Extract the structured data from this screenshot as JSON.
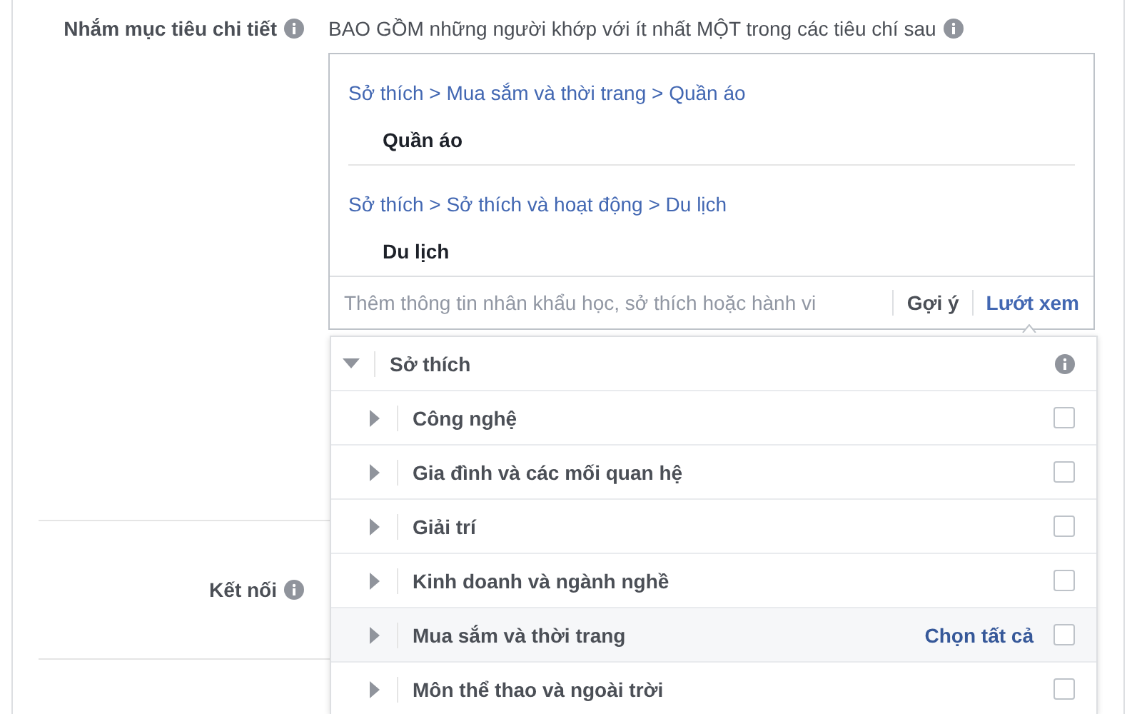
{
  "detailed_targeting": {
    "label": "Nhắm mục tiêu chi tiết",
    "description": "BAO GỒM những người khớp với ít nhất MỘT trong các tiêu chí sau",
    "selections": [
      {
        "path": "Sở thích > Mua sắm và thời trang > Quần áo",
        "item": "Quần áo"
      },
      {
        "path": "Sở thích > Sở thích và hoạt động > Du lịch",
        "item": "Du lịch"
      }
    ],
    "search": {
      "placeholder": "Thêm thông tin nhân khẩu học, sở thích hoặc hành vi"
    },
    "modes": [
      {
        "label": "Gợi ý",
        "selected": false
      },
      {
        "label": "Lướt xem",
        "selected": true
      }
    ]
  },
  "browse_panel": {
    "category": "Sở thích",
    "expanded": true,
    "select_all": "Chọn tất cả",
    "items": [
      {
        "label": "Công nghệ",
        "checked": false,
        "highlighted": false
      },
      {
        "label": "Gia đình và các mối quan hệ",
        "checked": false,
        "highlighted": false
      },
      {
        "label": "Giải trí",
        "checked": false,
        "highlighted": false
      },
      {
        "label": "Kinh doanh và ngành nghề",
        "checked": false,
        "highlighted": false
      },
      {
        "label": "Mua sắm và thời trang",
        "checked": false,
        "highlighted": true
      },
      {
        "label": "Môn thể thao và ngoài trời",
        "checked": false,
        "highlighted": false
      }
    ]
  },
  "connections": {
    "label": "Kết nối"
  }
}
